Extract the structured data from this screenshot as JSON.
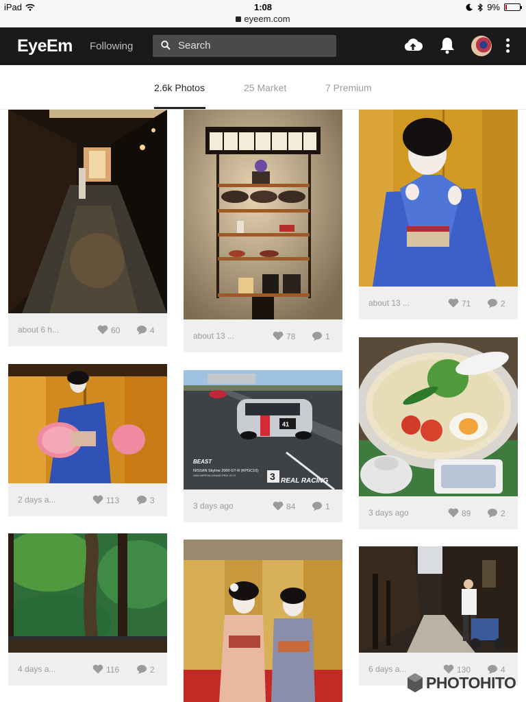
{
  "status": {
    "device": "iPad",
    "time": "1:08",
    "battery": "9%",
    "battery_level": 0.09
  },
  "browser": {
    "url": "eyeem.com"
  },
  "header": {
    "logo": "EyeEm",
    "following": "Following",
    "search_placeholder": "Search"
  },
  "tabs": [
    {
      "label": "2.6k Photos",
      "active": true
    },
    {
      "label": "25 Market",
      "active": false
    },
    {
      "label": "7 Premium",
      "active": false
    }
  ],
  "photos": [
    {
      "time": "about 6 h...",
      "likes": "60",
      "comments": "4"
    },
    {
      "time": "about 13 ...",
      "likes": "78",
      "comments": "1"
    },
    {
      "time": "about 13 ...",
      "likes": "71",
      "comments": "2"
    },
    {
      "time": "2 days a...",
      "likes": "113",
      "comments": "3"
    },
    {
      "time": "3 days ago",
      "likes": "84",
      "comments": "1",
      "caption_brand": "BEAST",
      "caption_car": "NISSAN Skyline 2000 GT-R (KPGC10)",
      "caption_sub": "1964 NIPPON GRAND PRIX GT-R",
      "caption_logo": "REAL RACING"
    },
    {
      "time": "3 days ago",
      "likes": "89",
      "comments": "2"
    },
    {
      "time": "4 days a...",
      "likes": "116",
      "comments": "2"
    },
    {
      "time": "",
      "likes": "",
      "comments": ""
    },
    {
      "time": "6 days a...",
      "likes": "130",
      "comments": "4"
    }
  ],
  "watermark": {
    "text": "PHOTOHITO"
  },
  "colors": {
    "header_bg": "#1a1a1a",
    "meta_bg": "#efefef",
    "meta_text": "#9b9b9b"
  },
  "icons": [
    "wifi-icon",
    "lock-icon",
    "moon-icon",
    "bluetooth-icon",
    "search-icon",
    "upload-cloud-icon",
    "bell-icon",
    "more-vertical-icon",
    "heart-icon",
    "comment-icon"
  ]
}
